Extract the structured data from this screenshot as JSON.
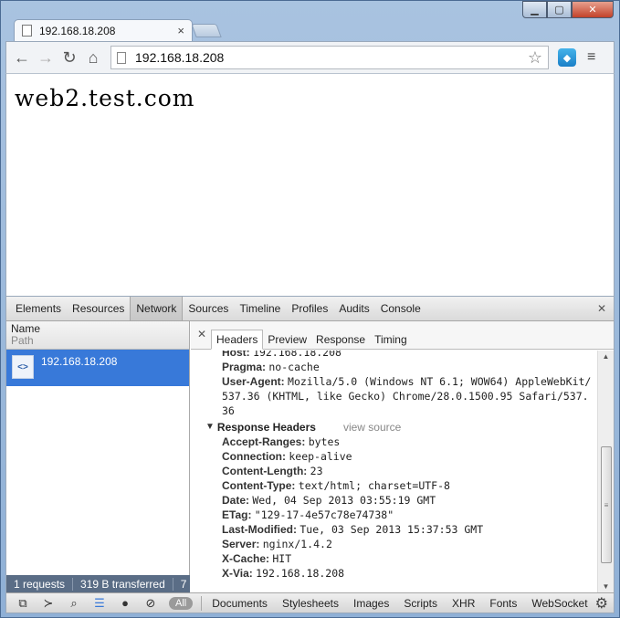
{
  "browser": {
    "tab_title": "192.168.18.208",
    "tab_close": "×",
    "url": "192.168.18.208"
  },
  "page": {
    "text": "web2.test.com"
  },
  "devtools": {
    "panels": [
      "Elements",
      "Resources",
      "Network",
      "Sources",
      "Timeline",
      "Profiles",
      "Audits",
      "Console"
    ],
    "active_panel": "Network",
    "columns": {
      "name": "Name",
      "path": "Path"
    },
    "request": {
      "name": "192.168.18.208"
    },
    "summary": {
      "requests": "1 requests",
      "transferred": "319 B transferred",
      "extra": "7"
    },
    "subtabs": [
      "Headers",
      "Preview",
      "Response",
      "Timing"
    ],
    "active_subtab": "Headers",
    "request_headers_partial": [
      {
        "key": "Host:",
        "value": "192.168.18.208"
      },
      {
        "key": "Pragma:",
        "value": "no-cache"
      },
      {
        "key": "User-Agent:",
        "value": "Mozilla/5.0 (Windows NT 6.1; WOW64) AppleWebKit/537.36 (KHTML, like Gecko) Chrome/28.0.1500.95 Safari/537.36"
      }
    ],
    "response_section": {
      "title": "Response Headers",
      "view_source": "view source"
    },
    "response_headers": [
      {
        "key": "Accept-Ranges:",
        "value": "bytes"
      },
      {
        "key": "Connection:",
        "value": "keep-alive"
      },
      {
        "key": "Content-Length:",
        "value": "23"
      },
      {
        "key": "Content-Type:",
        "value": "text/html; charset=UTF-8"
      },
      {
        "key": "Date:",
        "value": "Wed, 04 Sep 2013 03:55:19 GMT"
      },
      {
        "key": "ETag:",
        "value": "\"129-17-4e57c78e74738\""
      },
      {
        "key": "Last-Modified:",
        "value": "Tue, 03 Sep 2013 15:37:53 GMT"
      },
      {
        "key": "Server:",
        "value": "nginx/1.4.2"
      },
      {
        "key": "X-Cache:",
        "value": "HIT"
      },
      {
        "key": "X-Via:",
        "value": "192.168.18.208"
      }
    ],
    "filters": {
      "all": "All",
      "items": [
        "Documents",
        "Stylesheets",
        "Images",
        "Scripts",
        "XHR",
        "Fonts",
        "WebSocket"
      ]
    }
  }
}
